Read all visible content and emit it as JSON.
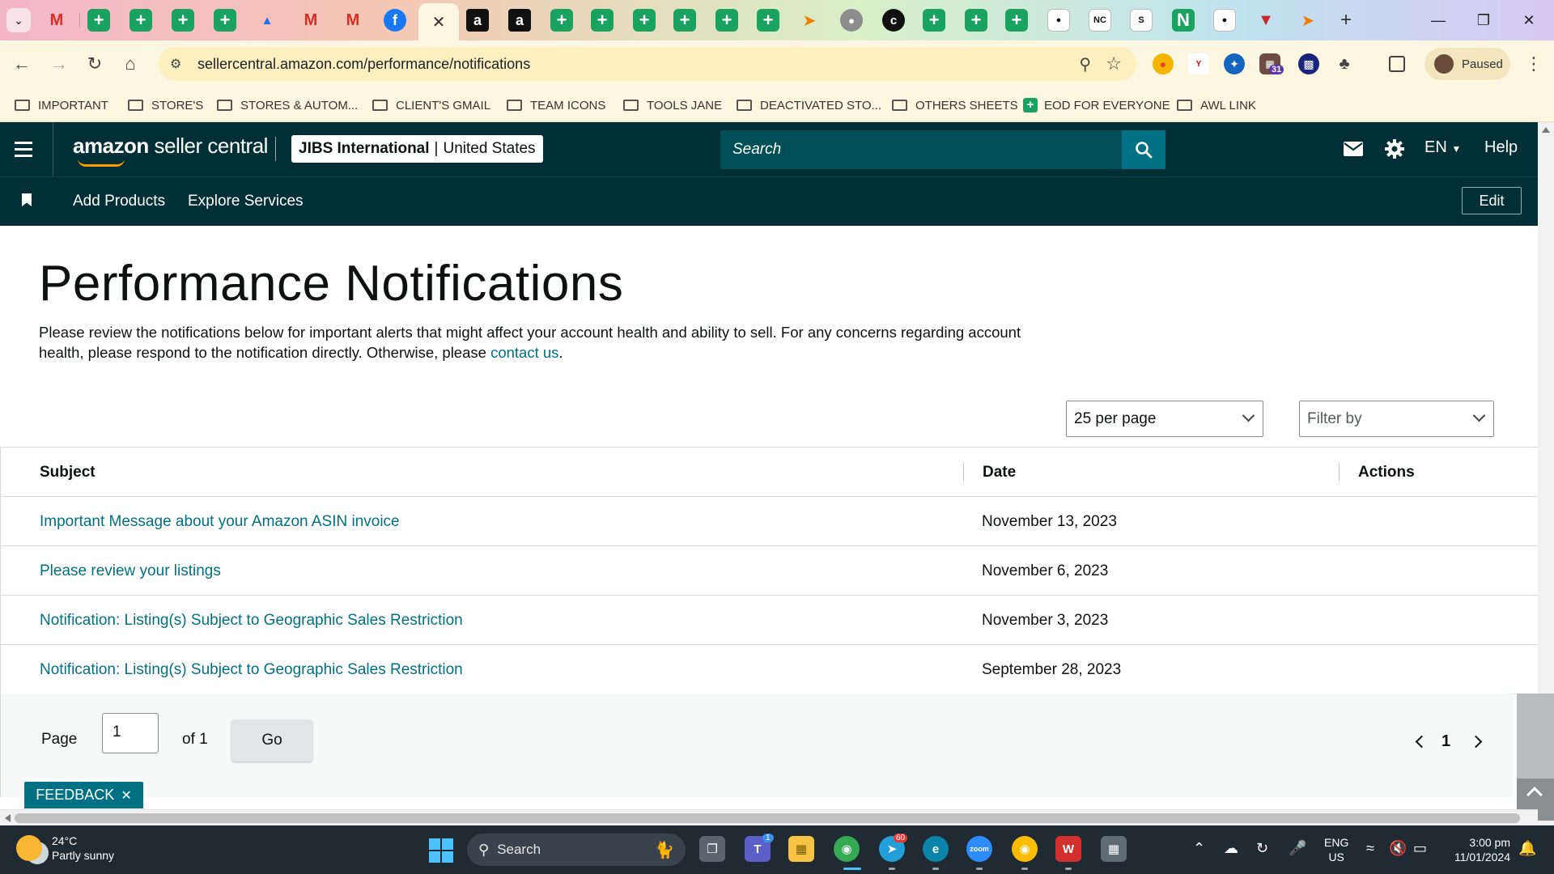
{
  "browser": {
    "url": "sellercentral.amazon.com/performance/notifications",
    "profile_status": "Paused",
    "extension_badge": "31",
    "bookmarks": [
      {
        "label": "IMPORTANT",
        "type": "folder"
      },
      {
        "label": "STORE'S",
        "type": "folder"
      },
      {
        "label": "STORES & AUTOM...",
        "type": "folder"
      },
      {
        "label": "CLIENT'S GMAIL",
        "type": "folder"
      },
      {
        "label": "TEAM ICONS",
        "type": "folder"
      },
      {
        "label": "TOOLS JANE",
        "type": "folder"
      },
      {
        "label": "DEACTIVATED STO...",
        "type": "folder"
      },
      {
        "label": "OTHERS SHEETS",
        "type": "folder"
      },
      {
        "label": "EOD FOR EVERYONE",
        "type": "sheet"
      },
      {
        "label": "AWL LINK",
        "type": "folder"
      }
    ]
  },
  "header": {
    "brand_prefix": "amazon",
    "brand_suffix": "seller central",
    "account_name": "JIBS International",
    "account_sep": "|",
    "account_region": "United States",
    "search_placeholder": "Search",
    "language": "EN",
    "help_label": "Help"
  },
  "subnav": {
    "add_products": "Add Products",
    "explore_services": "Explore Services",
    "edit_label": "Edit"
  },
  "page": {
    "title": "Performance Notifications",
    "intro_text": "Please review the notifications below for important alerts that might affect your account health and ability to sell. For any concerns regarding account health, please respond to the notification directly. Otherwise, please",
    "intro_link": "contact us",
    "intro_end": "."
  },
  "controls": {
    "per_page": "25 per page",
    "filter_placeholder": "Filter by"
  },
  "table": {
    "columns": [
      "Subject",
      "Date",
      "Actions"
    ],
    "rows": [
      {
        "subject": "Important Message about your Amazon ASIN invoice",
        "date": "November 13, 2023"
      },
      {
        "subject": "Please review your listings",
        "date": "November 6, 2023"
      },
      {
        "subject": "Notification: Listing(s) Subject to Geographic Sales Restriction",
        "date": "November 3, 2023"
      },
      {
        "subject": "Notification: Listing(s) Subject to Geographic Sales Restriction",
        "date": "September 28, 2023"
      }
    ]
  },
  "pagination": {
    "page_label": "Page",
    "page_value": "1",
    "of_label": "of 1",
    "go_label": "Go",
    "current_page": "1"
  },
  "feedback": {
    "label": "FEEDBACK"
  },
  "taskbar": {
    "temperature": "24°C",
    "weather": "Partly sunny",
    "search_label": "Search",
    "lang_line1": "ENG",
    "lang_line2": "US",
    "time": "3:00 pm",
    "date": "11/01/2024",
    "teams_badge": "1",
    "telegram_badge": "60"
  },
  "colors": {
    "header_bg": "#002f36",
    "link": "#007185",
    "search_bg": "#004e58"
  }
}
